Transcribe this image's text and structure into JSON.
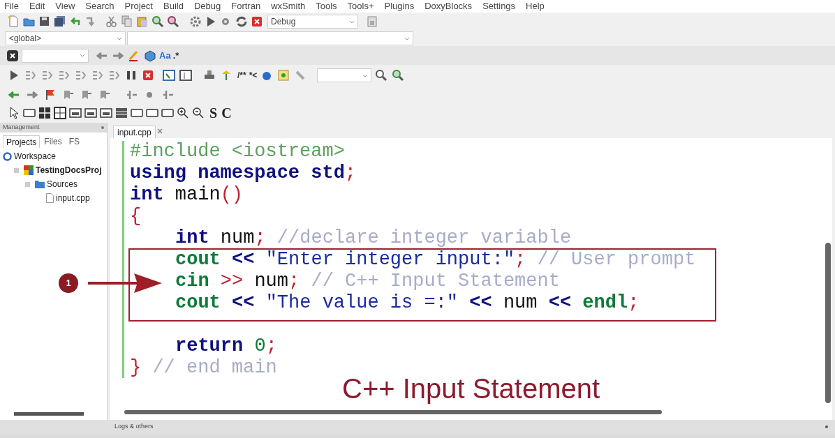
{
  "menu": [
    "File",
    "Edit",
    "View",
    "Search",
    "Project",
    "Build",
    "Debug",
    "Fortran",
    "wxSmith",
    "Tools",
    "Tools+",
    "Plugins",
    "DoxyBlocks",
    "Settings",
    "Help"
  ],
  "build_target": "Debug",
  "scope": "<global>",
  "toolbar_glyphs": {
    "match_case": "Aa",
    "regex": ".*",
    "doxy_block": "/**",
    "doxy_line": "*<",
    "static_text": "S",
    "check": "C"
  },
  "management": {
    "title": "Management",
    "tabs": [
      {
        "label": "Projects",
        "selected": true
      },
      {
        "label": "Files",
        "selected": false
      },
      {
        "label": "FS",
        "selected": false
      }
    ],
    "tree": [
      {
        "label": "Workspace",
        "kind": "workspace",
        "children": [
          {
            "label": "TestingDocsProj",
            "kind": "project",
            "children": [
              {
                "label": "Sources",
                "kind": "folder",
                "children": [
                  {
                    "label": "input.cpp",
                    "kind": "file"
                  }
                ]
              }
            ]
          }
        ]
      }
    ]
  },
  "editor": {
    "tabs": [
      {
        "label": "input.cpp",
        "selected": true
      }
    ],
    "lines": [
      {
        "kind": "code",
        "indented": false,
        "tokens": [
          {
            "text": "#include <iostream>",
            "kind": "preprocessor"
          }
        ]
      },
      {
        "kind": "code",
        "indented": false,
        "tokens": [
          {
            "text": "using namespace std",
            "kind": "keyword"
          },
          {
            "text": ";",
            "kind": "punct"
          }
        ]
      },
      {
        "kind": "code",
        "indented": false,
        "tokens": [
          {
            "text": "int",
            "kind": "keyword"
          },
          {
            "text": " main",
            "kind": "plain"
          },
          {
            "text": "()",
            "kind": "punct"
          }
        ]
      },
      {
        "kind": "code",
        "indented": false,
        "tokens": [
          {
            "text": "{",
            "kind": "punct"
          }
        ]
      },
      {
        "kind": "code",
        "indented": true,
        "tokens": [
          {
            "text": "int",
            "kind": "keyword"
          },
          {
            "text": " num",
            "kind": "plain"
          },
          {
            "text": ";",
            "kind": "punct"
          },
          {
            "text": " //declare integer variable",
            "kind": "comment"
          }
        ]
      },
      {
        "kind": "code",
        "indented": true,
        "tokens": [
          {
            "text": "cout",
            "kind": "identifier"
          },
          {
            "text": " << ",
            "kind": "operator"
          },
          {
            "text": "\"Enter integer input:\"",
            "kind": "string"
          },
          {
            "text": ";",
            "kind": "punct"
          },
          {
            "text": " // User prompt",
            "kind": "comment"
          }
        ]
      },
      {
        "kind": "code",
        "indented": true,
        "tokens": [
          {
            "text": "cin",
            "kind": "identifier"
          },
          {
            "text": " >> ",
            "kind": "punct"
          },
          {
            "text": "num",
            "kind": "plain"
          },
          {
            "text": ";",
            "kind": "punct"
          },
          {
            "text": " // C++ Input Statement",
            "kind": "comment"
          }
        ]
      },
      {
        "kind": "code",
        "indented": true,
        "tokens": [
          {
            "text": "cout",
            "kind": "identifier"
          },
          {
            "text": " << ",
            "kind": "operator"
          },
          {
            "text": "\"The value is =:\"",
            "kind": "string"
          },
          {
            "text": " << ",
            "kind": "operator"
          },
          {
            "text": "num",
            "kind": "plain"
          },
          {
            "text": " << ",
            "kind": "operator"
          },
          {
            "text": "endl",
            "kind": "identifier"
          },
          {
            "text": ";",
            "kind": "punct"
          }
        ]
      },
      {
        "kind": "blank"
      },
      {
        "kind": "code",
        "indented": true,
        "tokens": [
          {
            "text": "return",
            "kind": "keyword"
          },
          {
            "text": " 0",
            "kind": "number"
          },
          {
            "text": ";",
            "kind": "punct"
          }
        ]
      },
      {
        "kind": "code",
        "indented": false,
        "tokens": [
          {
            "text": "}",
            "kind": "punct"
          },
          {
            "text": " // end main",
            "kind": "comment"
          }
        ]
      }
    ],
    "callout": {
      "number": "1",
      "caption": "C++ Input Statement"
    }
  },
  "bottom_panel": {
    "title": "Logs & others"
  }
}
